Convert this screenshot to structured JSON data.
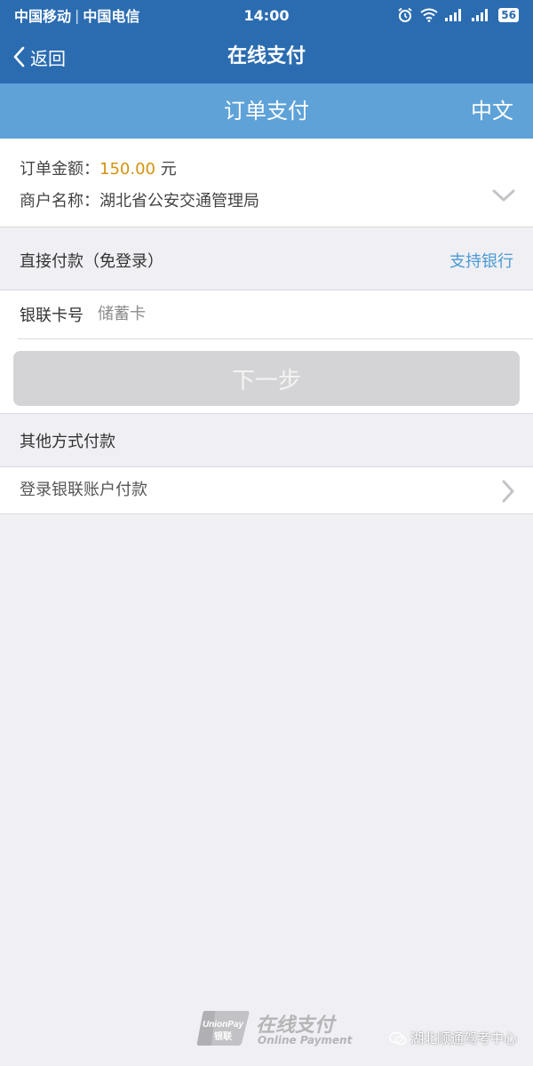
{
  "status_bar": {
    "carrier1": "中国移动",
    "carrier2": "中国电信",
    "time": "14:00",
    "battery": "56"
  },
  "nav": {
    "back_label": "返回",
    "title": "在线支付"
  },
  "sub_header": {
    "title": "订单支付",
    "language": "中文"
  },
  "order": {
    "amount_label": "订单金额：",
    "amount_value": "150.00",
    "amount_unit": " 元",
    "merchant_label": "商户名称：",
    "merchant_value": "湖北省公安交通管理局"
  },
  "direct_pay": {
    "title": "直接付款（免登录）",
    "support_bank": "支持银行",
    "card_label": "银联卡号",
    "card_placeholder": "储蓄卡",
    "next_button": "下一步"
  },
  "other_pay": {
    "title": "其他方式付款",
    "login_option": "登录银联账户付款"
  },
  "footer": {
    "logo_text": "UnionPay",
    "logo_cn": "银联",
    "title": "在线支付",
    "subtitle": "Online Payment",
    "watermark": "湖北顺通驾考中心"
  },
  "colors": {
    "nav_bg": "#2b6cb1",
    "sub_header_bg": "#5ea2d8",
    "amount": "#d4920f",
    "link": "#4a9bd4"
  }
}
